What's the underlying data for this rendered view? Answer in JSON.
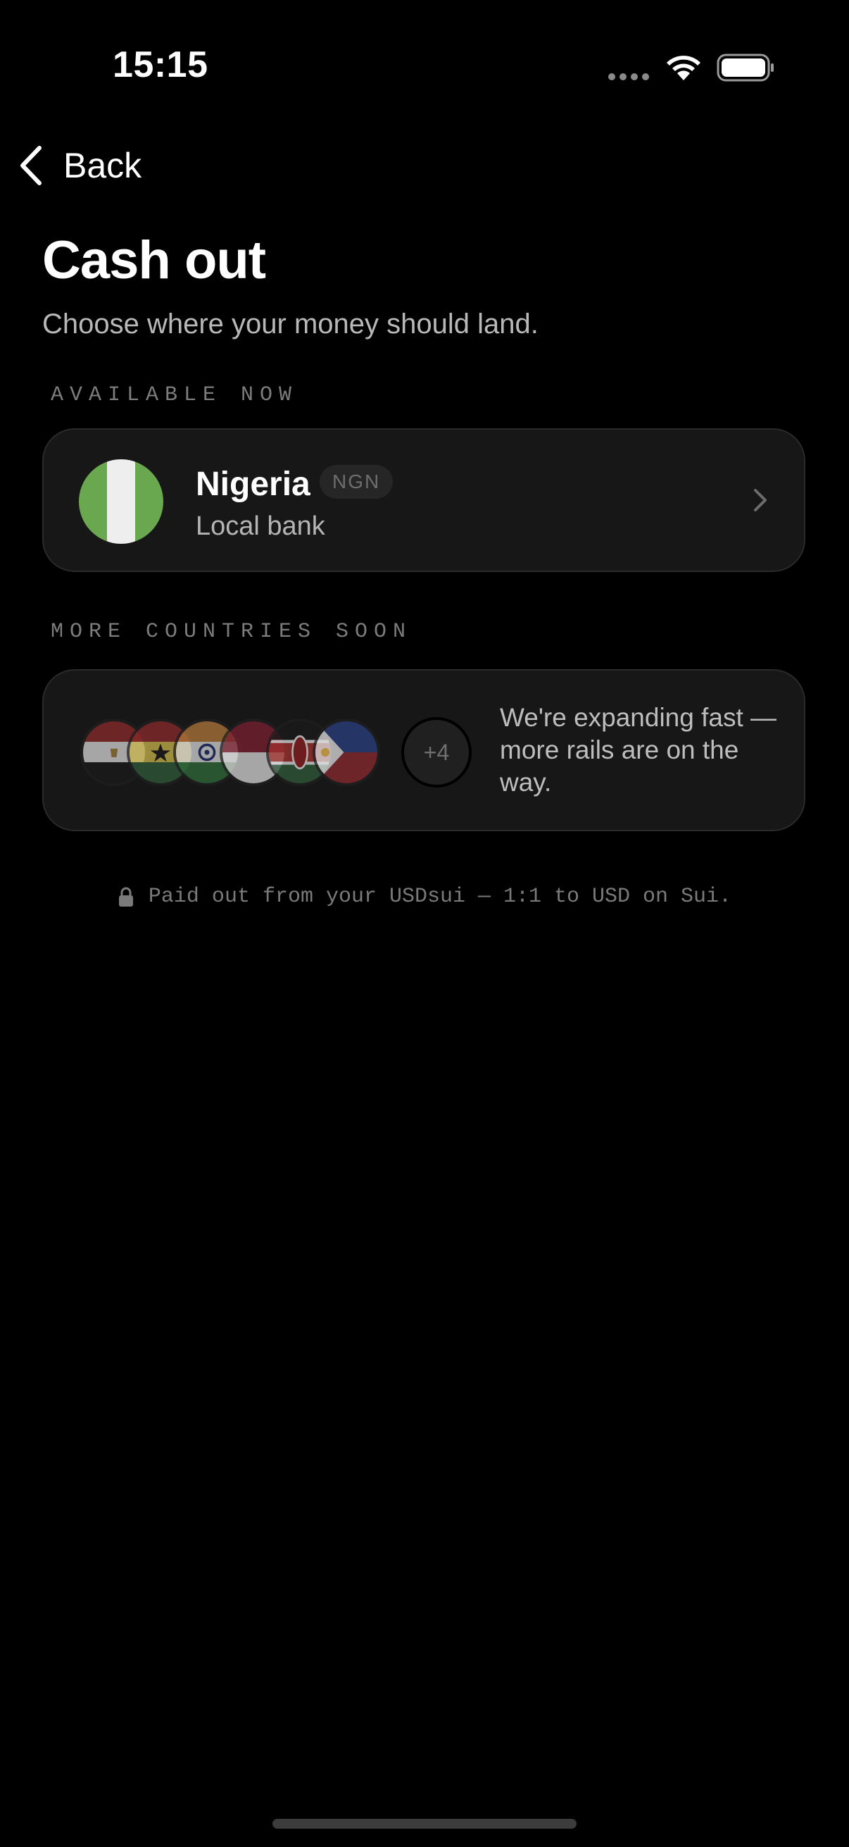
{
  "status_bar": {
    "time": "15:15"
  },
  "nav": {
    "back_label": "Back"
  },
  "header": {
    "title": "Cash out",
    "subtitle": "Choose where your money should land."
  },
  "sections": {
    "available": "AVAILABLE NOW",
    "soon": "MORE COUNTRIES SOON"
  },
  "available_country": {
    "name": "Nigeria",
    "currency": "NGN",
    "method": "Local bank"
  },
  "coming_soon": {
    "more_count": "+4",
    "text": "We're expanding fast — more rails are on the way."
  },
  "footnote": "Paid out from your USDsui — 1:1 to USD on Sui.",
  "colors": {
    "background": "#000000",
    "card": "#171717",
    "nigeria_green": "#6aa84f",
    "nigeria_white": "#eeeeee"
  }
}
